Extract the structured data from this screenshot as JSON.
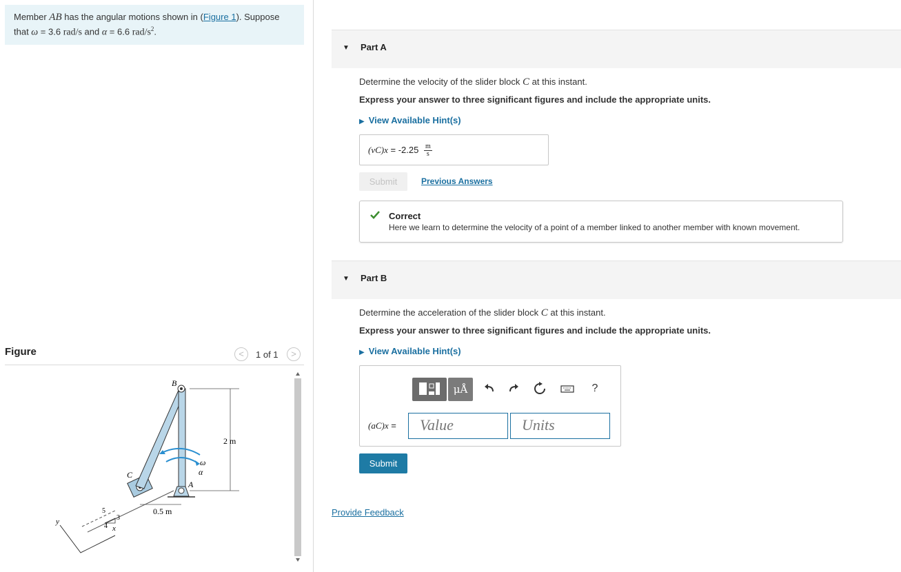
{
  "problem": {
    "text_1": "Member ",
    "member": "AB",
    "text_2": " has the angular motions shown in (",
    "figure_link": "Figure 1",
    "text_3": "). Suppose that ",
    "omega_sym": "ω",
    "omega_eq": " = 3.6 ",
    "omega_unit": "rad/s",
    "text_4": " and ",
    "alpha_sym": "α",
    "alpha_eq": " = 6.6 ",
    "alpha_unit": "rad/s",
    "alpha_exp": "2",
    "text_5": "."
  },
  "figure": {
    "title": "Figure",
    "counter": "1 of 1",
    "prev": "<",
    "next": ">",
    "labels": {
      "B": "B",
      "C": "C",
      "A": "A",
      "omega": "ω",
      "alpha": "α",
      "height": "2 m",
      "width": "0.5 m",
      "s5": "5",
      "s3": "3",
      "s4": "4",
      "x": "x",
      "y": "y"
    }
  },
  "partA": {
    "label": "Part A",
    "question_1": "Determine the velocity of the slider block ",
    "question_var": "C",
    "question_2": " at this instant.",
    "instruction": "Express your answer to three significant figures and include the appropriate units.",
    "hint": "View Available Hint(s)",
    "answer_lhs": "(vC)x",
    "answer_eq": " = ",
    "answer_value": "-2.25",
    "answer_unit_num": "m",
    "answer_unit_den": "s",
    "submit": "Submit",
    "previous_answers": "Previous Answers",
    "correct_title": "Correct",
    "correct_message": "Here we learn to determine the velocity of a point of a member linked to another member with known movement."
  },
  "partB": {
    "label": "Part B",
    "question_1": "Determine the acceleration of the slider block ",
    "question_var": "C",
    "question_2": " at this instant.",
    "instruction": "Express your answer to three significant figures and include the appropriate units.",
    "hint": "View Available Hint(s)",
    "answer_lhs": "(aC)x",
    "answer_eq": " =",
    "value_placeholder": "Value",
    "units_placeholder": "Units",
    "symbols_label": "μÅ",
    "help": "?",
    "submit": "Submit"
  },
  "feedback": "Provide Feedback",
  "colors": {
    "link": "#1a6fa0",
    "submit_bg": "#1e7ba5",
    "problem_bg": "#e8f4f8",
    "correct_check": "#3c8d2f"
  }
}
